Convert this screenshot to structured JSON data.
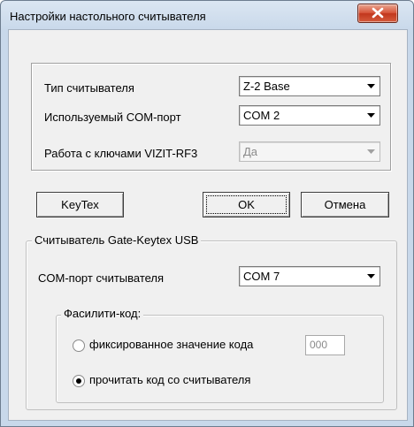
{
  "window": {
    "title": "Настройки настольного считывателя",
    "close_icon": "close-x-icon"
  },
  "reader_settings": {
    "reader_type_label": "Тип считывателя",
    "reader_type_value": "Z-2 Base",
    "com_port_label": "Используемый COM-порт",
    "com_port_value": "COM 2",
    "vizit_label": "Работа с ключами VIZIT-RF3",
    "vizit_value": "Да"
  },
  "buttons": {
    "keytex": "KeyTex",
    "ok": "OK",
    "cancel": "Отмена"
  },
  "gate_group": {
    "title": "Считыватель Gate-Keytex USB",
    "com_port_label": "COM-порт считывателя",
    "com_port_value": "COM 7",
    "facility": {
      "title": "Фасилити-код:",
      "option_fixed": "фиксированное значение кода",
      "fixed_value": "000",
      "option_read": "прочитать код со считывателя",
      "selected": "read"
    }
  }
}
